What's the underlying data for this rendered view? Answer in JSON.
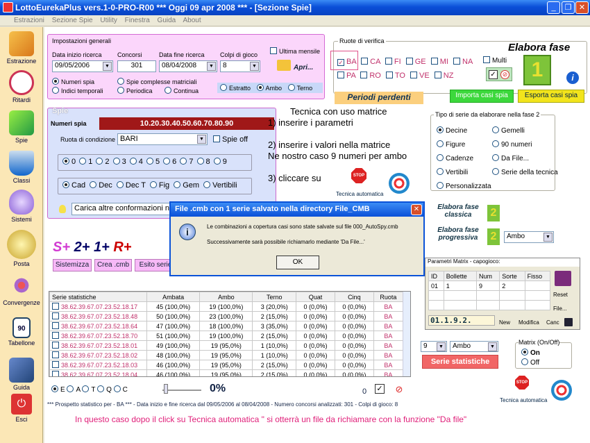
{
  "window": {
    "title": "LottoEurekaPlus vers.1-0-PRO-R00  ***  Oggi 09 apr 2008  ***   - [Sezione Spie]"
  },
  "menu": [
    "Estrazioni",
    "Sezione Spie",
    "Utility",
    "Finestra",
    "Guida",
    "About"
  ],
  "sidebar": [
    "Estrazione",
    "Ritardi",
    "Spie",
    "Classi",
    "Sistemi",
    "Posta",
    "Convergenze",
    "Tabellone",
    "Guida",
    "Esci"
  ],
  "settings": {
    "group_label": "Impostazioni generali",
    "data_inizio_label": "Data inizio ricerca",
    "data_inizio": "09/05/2006",
    "concorsi_label": "Concorsi",
    "concorsi": "301",
    "data_fine_label": "Data fine ricerca",
    "data_fine": "08/04/2008",
    "colpi_label": "Colpi di gioco",
    "colpi": "8",
    "ultima_mensile": "Ultima mensile",
    "apri": "Apri...",
    "numeri_spia": "Numeri spia",
    "indici_temporali": "Indici temporali",
    "spie_complesse": "Spie complesse matriciali",
    "periodica": "Periodica",
    "continua": "Continua",
    "estratto": "Estratto",
    "ambo": "Ambo",
    "terno": "Terno"
  },
  "ruote": {
    "label": "Ruote di verifica",
    "items": [
      "BA",
      "CA",
      "FI",
      "GE",
      "MI",
      "NA",
      "PA",
      "RO",
      "TO",
      "VE",
      "NZ"
    ],
    "multi": "Multi",
    "checked_mark": "✓"
  },
  "elabora_fase": "Elabora fase",
  "fase_number": "1",
  "periodi_perdenti": "Periodi perdenti",
  "importa": "Importa casi spia",
  "esporta": "Esporta casi spia",
  "spie": {
    "label": "Spie",
    "numeri_label": "Numeri spia",
    "numeri": "10.20.30.40.50.60.70.80.90",
    "ruota_label": "Ruota di condizione",
    "ruota": "BARI",
    "spie_off": "Spie off",
    "digits": [
      "0",
      "1",
      "2",
      "3",
      "4",
      "5",
      "6",
      "7",
      "8",
      "9"
    ],
    "cad_options": [
      "Cad",
      "Dec",
      "Dec T",
      "Fig",
      "Gem",
      "Vertibili"
    ],
    "carica": "Carica altre conformazioni nu"
  },
  "instructions": [
    "Tecnica con uso matrice",
    "1) inserire i parametri",
    "2) inserire i valori nella matrice",
    "Ne nostro caso 9 numeri per ambo",
    "3) cliccare su"
  ],
  "stop_label": "STOP",
  "tecnica_automatica": "Tecnica automatica",
  "tipo_serie": {
    "label": "Tipo di serie da elaborare nella fase 2",
    "col1": [
      "Decine",
      "Figure",
      "Cadenze",
      "Vertibili",
      "Personalizzata"
    ],
    "col2": [
      "Gemelli",
      "90 numeri",
      "Da File...",
      "Serie della tecnica"
    ]
  },
  "elabora_classica": "Elabora fase classica",
  "elabora_progressiva": "Elabora fase progressiva",
  "fase2_number": "2",
  "ambo_select": "Ambo",
  "splus": {
    "s": "S+",
    "two": "2+",
    "one": "1+",
    "r": "R+"
  },
  "buttons": {
    "sistemizza": "Sistemizza",
    "crea": "Crea .cmb",
    "esito": "Esito serie"
  },
  "matrix": {
    "label": "Parametri Matrix - capogioco:",
    "headers": [
      "ID",
      "Bollette",
      "Num",
      "Sorte",
      "Fisso"
    ],
    "row": [
      "01",
      "1",
      "9",
      "2",
      ""
    ],
    "code": "01.1.9.2.",
    "new": "New",
    "modifica": "Modifica",
    "canc": "Canc",
    "reset": "Reset",
    "file": "File..."
  },
  "table": {
    "headers": [
      "Serie statistiche",
      "Ambata",
      "Ambo",
      "Terno",
      "Quat",
      "Cinq",
      "Ruota"
    ],
    "rows": [
      [
        "38.62.39.67.07.23.52.18.17",
        "45 (100,0%)",
        "19 (100,0%)",
        "3 (20,0%)",
        "0 (0,0%)",
        "0 (0,0%)",
        "BA"
      ],
      [
        "38.62.39.67.07.23.52.18.48",
        "50 (100,0%)",
        "23 (100,0%)",
        "2 (15,0%)",
        "0 (0,0%)",
        "0 (0,0%)",
        "BA"
      ],
      [
        "38.62.39.67.07.23.52.18.64",
        "47 (100,0%)",
        "18 (100,0%)",
        "3 (35,0%)",
        "0 (0,0%)",
        "0 (0,0%)",
        "BA"
      ],
      [
        "38.62.39.67.07.23.52.18.70",
        "51 (100,0%)",
        "19 (100,0%)",
        "2 (15,0%)",
        "0 (0,0%)",
        "0 (0,0%)",
        "BA"
      ],
      [
        "38.62.39.67.07.23.52.18.01",
        "49 (100,0%)",
        "19 (95,0%)",
        "1 (10,0%)",
        "0 (0,0%)",
        "0 (0,0%)",
        "BA"
      ],
      [
        "38.62.39.67.07.23.52.18.02",
        "48 (100,0%)",
        "19 (95,0%)",
        "1 (10,0%)",
        "0 (0,0%)",
        "0 (0,0%)",
        "BA"
      ],
      [
        "38.62.39.67.07.23.52.18.03",
        "46 (100,0%)",
        "19 (95,0%)",
        "2 (15,0%)",
        "0 (0,0%)",
        "0 (0,0%)",
        "BA"
      ],
      [
        "38.62.39.67.07.23.52.18.04",
        "46 (100,0%)",
        "19 (95,0%)",
        "2 (15,0%)",
        "0 (0,0%)",
        "0 (0,0%)",
        "BA"
      ]
    ]
  },
  "bottom": {
    "letters": [
      "E",
      "A",
      "T",
      "Q",
      "C"
    ],
    "percent": "0%",
    "zero": "0",
    "matrix_label": "Matrix (On/Off)",
    "on": "On",
    "off": "Off",
    "colpi": "9",
    "ambo": "Ambo",
    "serie_stat": "Serie statistiche"
  },
  "status": "*** Prospetto statistico per  - BA *** - Data inizio e fine ricerca dal 09/05/2006 al 08/04/2008 - Numero concorsi analizzati: 301 - Colpi di gioco: 8",
  "caption": "In questo caso dopo il click su Tecnica automatica \" si otterrà un file da richiamare con la funzione \"Da file\"",
  "dialog": {
    "title": "File .cmb con 1 serie salvato nella directory File_CMB",
    "line1": "Le combinazioni a copertura casi sono state salvate sul file 000_AutoSpy.cmb",
    "line2": "Successivamente sarà possibile richiamarlo mediante 'Da File...'",
    "ok": "OK"
  }
}
